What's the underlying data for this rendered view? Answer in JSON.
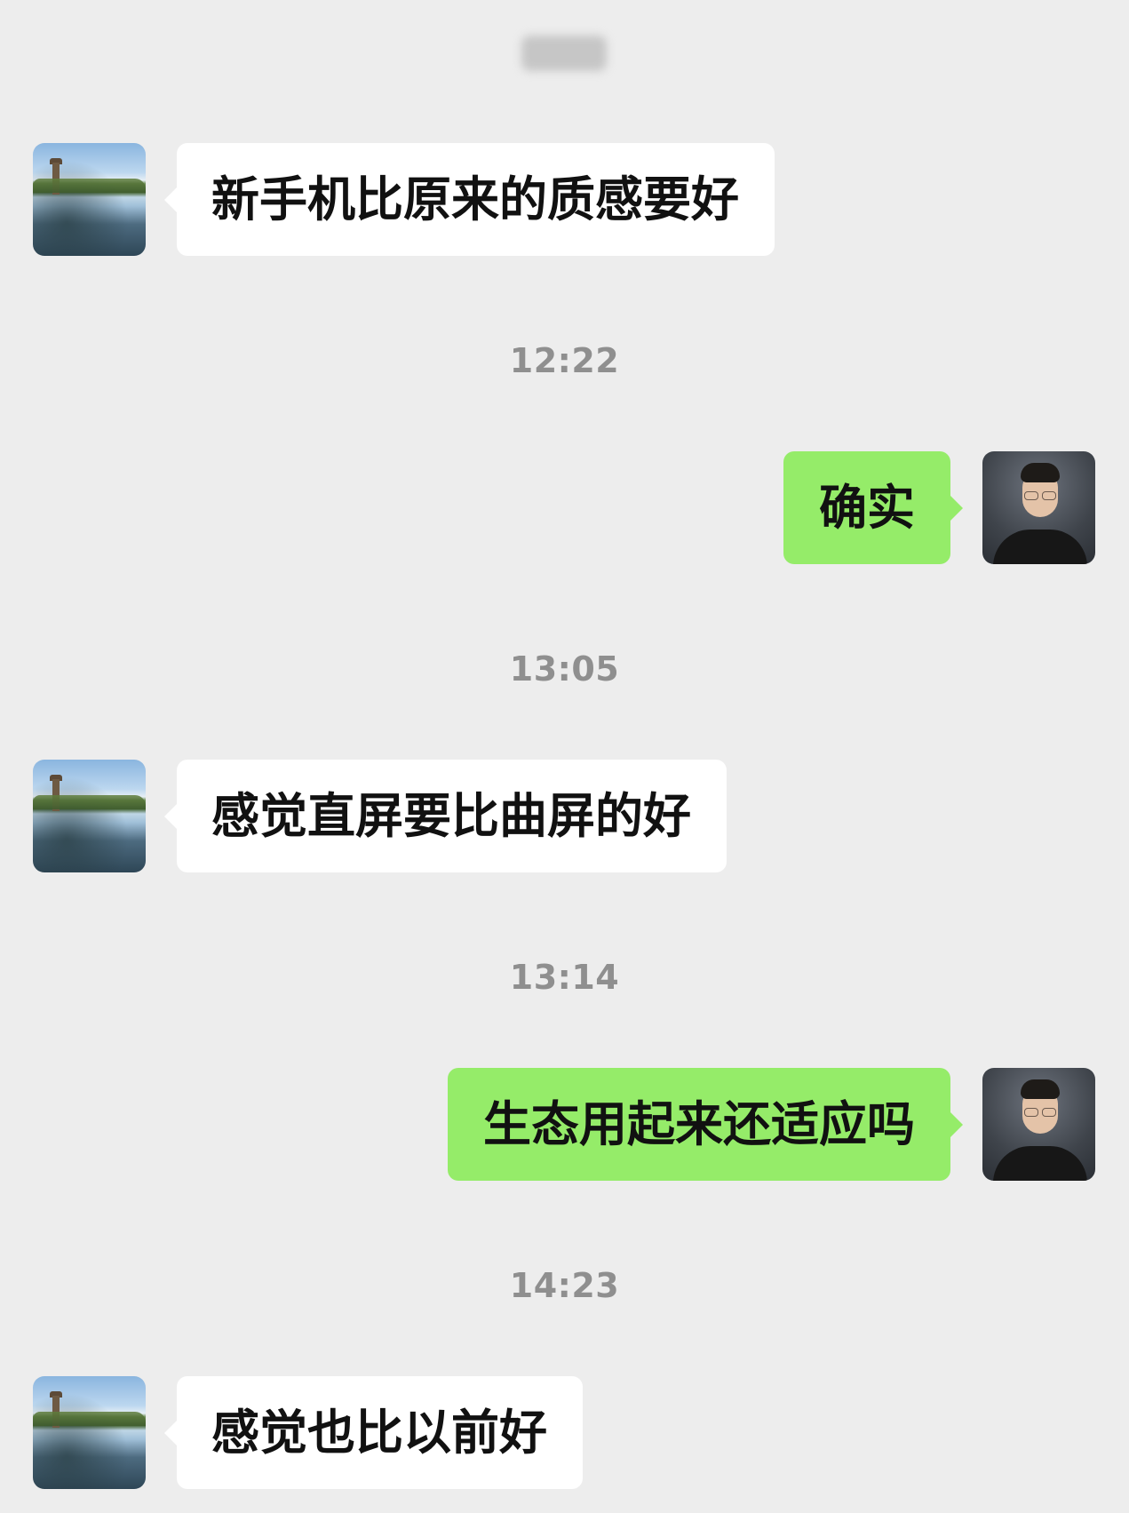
{
  "chat": {
    "messages": [
      {
        "text": "新手机比原来的质感要好"
      },
      {
        "text": "确实"
      },
      {
        "text": "感觉直屏要比曲屏的好"
      },
      {
        "text": "生态用起来还适应吗"
      },
      {
        "text": "感觉也比以前好"
      }
    ],
    "times": [
      "12:22",
      "13:05",
      "13:14",
      "14:23"
    ]
  },
  "colors": {
    "background": "#ededed",
    "incoming_bubble": "#ffffff",
    "outgoing_bubble": "#95ec69",
    "timestamp_text": "#8f8f8f"
  },
  "icons": {
    "contact_avatar": "lake-landscape-avatar",
    "self_avatar": "man-portrait-avatar"
  }
}
